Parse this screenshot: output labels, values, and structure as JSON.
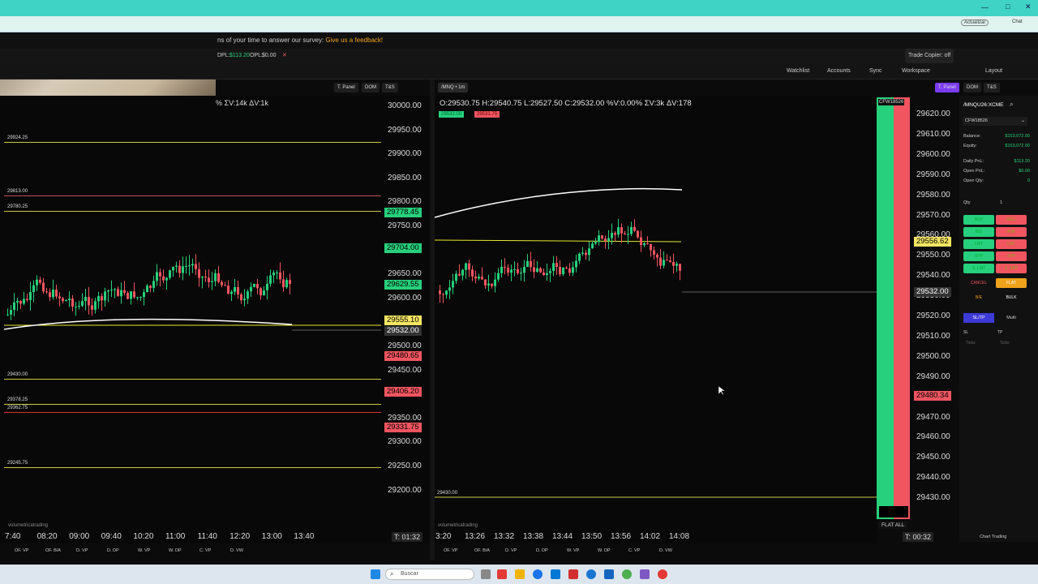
{
  "browser": {
    "update_label": "Actualizar",
    "chat_label": "Chat"
  },
  "survey": {
    "text": "ns of your time to answer our survey:",
    "link": "Give us a feedback!"
  },
  "pnl": {
    "dpl_label": "DPL:",
    "dpl_value": "$113.20",
    "opl_label": "OPL:",
    "opl_value": "$0.00",
    "trade_copier": "Trade Copier: off"
  },
  "toolbar": {
    "watchlist": "Watchlist",
    "accounts": "Accounts",
    "sync": "Sync",
    "workspace": "Workspace",
    "layout": "Layout"
  },
  "left_chart": {
    "header": "% ΣV:14k ΔV:1k",
    "tabs": [
      "T. Panel",
      "DOM",
      "T&S"
    ],
    "price_ticks": [
      "30000.00",
      "29950.00",
      "29900.00",
      "29850.00",
      "29800.00",
      "29750.00",
      "29700.00",
      "29650.00",
      "29600.00",
      "29550.00",
      "29500.00",
      "29450.00",
      "29400.00",
      "29350.00",
      "29300.00",
      "29250.00",
      "29200.00"
    ],
    "price_labels": [
      {
        "text": "29778.45",
        "color": "#26d07c"
      },
      {
        "text": "29704.00",
        "color": "#26d07c"
      },
      {
        "text": "29629.55",
        "color": "#26d07c"
      },
      {
        "text": "29555.10",
        "color": "#f5e663"
      },
      {
        "text": "29532.00",
        "color": "#333333"
      },
      {
        "text": "29480.65",
        "color": "#f05560"
      },
      {
        "text": "29406.20",
        "color": "#f05560"
      },
      {
        "text": "29331.75",
        "color": "#f05560"
      }
    ],
    "levels": [
      "29924.25",
      "29813.00",
      "29780.25",
      "29430.00",
      "29378.25",
      "29362.75",
      "29245.75"
    ],
    "times": [
      "7:40",
      "08:20",
      "09:00",
      "09:40",
      "10:20",
      "11:00",
      "11:40",
      "12:20",
      "13:00",
      "13:40"
    ],
    "timer": "T: 01:32",
    "watermark": "volumetricatrading",
    "bottom_tabs": [
      "OF. VP",
      "OF. B/A",
      "D. VP",
      "D. DP",
      "W. VP",
      "W. DP",
      "C. VP",
      "D. VW"
    ]
  },
  "right_chart": {
    "tabs_symbol": "/MNQ • 1m",
    "ohlc": "O:29530.75  H:29540.75  L:29527.50  C:29532.00  %V:0.00%  ΣV:3k  ΔV:178",
    "bid": "29532.00",
    "ask": "29531.75",
    "account_tag": "CFW18526",
    "price_ticks": [
      "29620.00",
      "29610.00",
      "29600.00",
      "29590.00",
      "29580.00",
      "29570.00",
      "29560.00",
      "29550.00",
      "29540.00",
      "29530.00",
      "29520.00",
      "29510.00",
      "29500.00",
      "29490.00",
      "29480.00",
      "29470.00",
      "29460.00",
      "29450.00",
      "29440.00",
      "29430.00"
    ],
    "yellow_label": "29556.62",
    "current_label": "29532.00",
    "red_label": "29480.34",
    "level": "29430.00",
    "times": [
      "3:20",
      "13:26",
      "13:32",
      "13:38",
      "13:44",
      "13:50",
      "13:56",
      "14:02",
      "14:08"
    ],
    "timer": "T: 00:32",
    "flat_all": "FLAT ALL",
    "top_tabs": [
      "T. Panel",
      "DOM",
      "T&S"
    ]
  },
  "panel": {
    "symbol": "/MNQU26:XCME",
    "account": "CFW18526",
    "rows": [
      {
        "label": "Balance:",
        "value": "$153,072.00"
      },
      {
        "label": "Equity:",
        "value": "$153,072.00"
      },
      {
        "label": "Daily PnL:",
        "value": "$113.20"
      },
      {
        "label": "Open PnL:",
        "value": "$0.00"
      },
      {
        "label": "Open Qty:",
        "value": "0"
      }
    ],
    "qty_label": "Qty",
    "qty_value": "1",
    "buttons_left": [
      "BUY",
      "BID",
      "LMT",
      "STP",
      "S. LMT",
      "CANCEL",
      "B/E"
    ],
    "buttons_right": [
      "SELL",
      "ASK",
      "LMT",
      "STP",
      "S. LMT",
      "FLAT",
      "BULK"
    ],
    "sltp": "SL/TP",
    "multi": "Multi",
    "sl": "SL",
    "tp": "TP",
    "ticks": "Ticks",
    "chart_trading": "Chart Trading"
  },
  "taskbar": {
    "search": "Buscar"
  }
}
